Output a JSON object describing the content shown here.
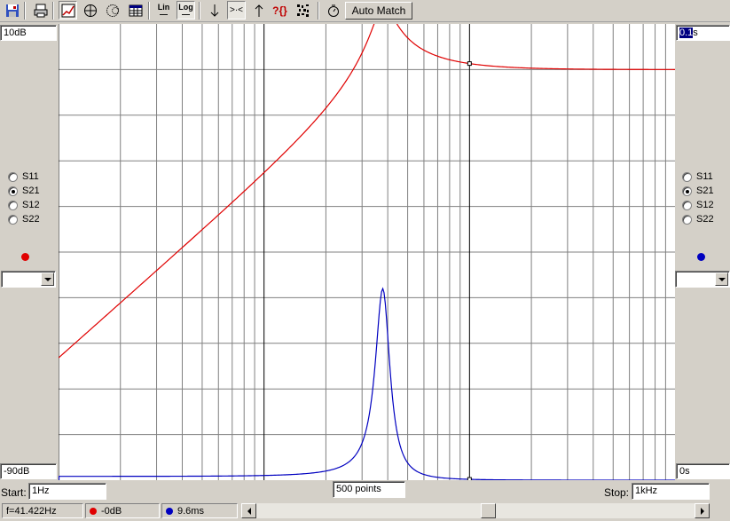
{
  "toolbar": {
    "auto_match_label": "Auto Match",
    "lin_label_top": "Lin",
    "lin_label_bottom": "—",
    "log_label_top": "Log",
    "log_label_bottom": "—",
    "help_glyph": "?{}",
    "marker_glyph": ">·<"
  },
  "left": {
    "top_value": "10dB",
    "bottom_value": "-90dB",
    "params": [
      "S11",
      "S21",
      "S12",
      "S22"
    ],
    "selected": "S21",
    "trace_color": "#e00000"
  },
  "right": {
    "top_value_selected": "0.1",
    "top_value_unit": "s",
    "bottom_value": "0s",
    "params": [
      "S11",
      "S21",
      "S12",
      "S22"
    ],
    "selected": "S21",
    "trace_color": "#0000c0"
  },
  "sweep": {
    "start_label": "Start:",
    "start_value": "1Hz",
    "points_value": "500 points",
    "stop_label": "Stop:",
    "stop_value": "1kHz"
  },
  "status": {
    "frequency": "f=41.422Hz",
    "magnitude": "-0dB",
    "group_delay": "9.6ms",
    "magnitude_color": "#e00000",
    "delay_color": "#0000c0"
  },
  "plot": {
    "x_scale": "log",
    "x_range_hz": [
      1,
      1000
    ],
    "y_left_range_db": [
      -90,
      10
    ],
    "y_right_range_s": [
      0,
      0.1
    ],
    "grid": true,
    "cursor_frequency_hz": 41.422
  }
}
